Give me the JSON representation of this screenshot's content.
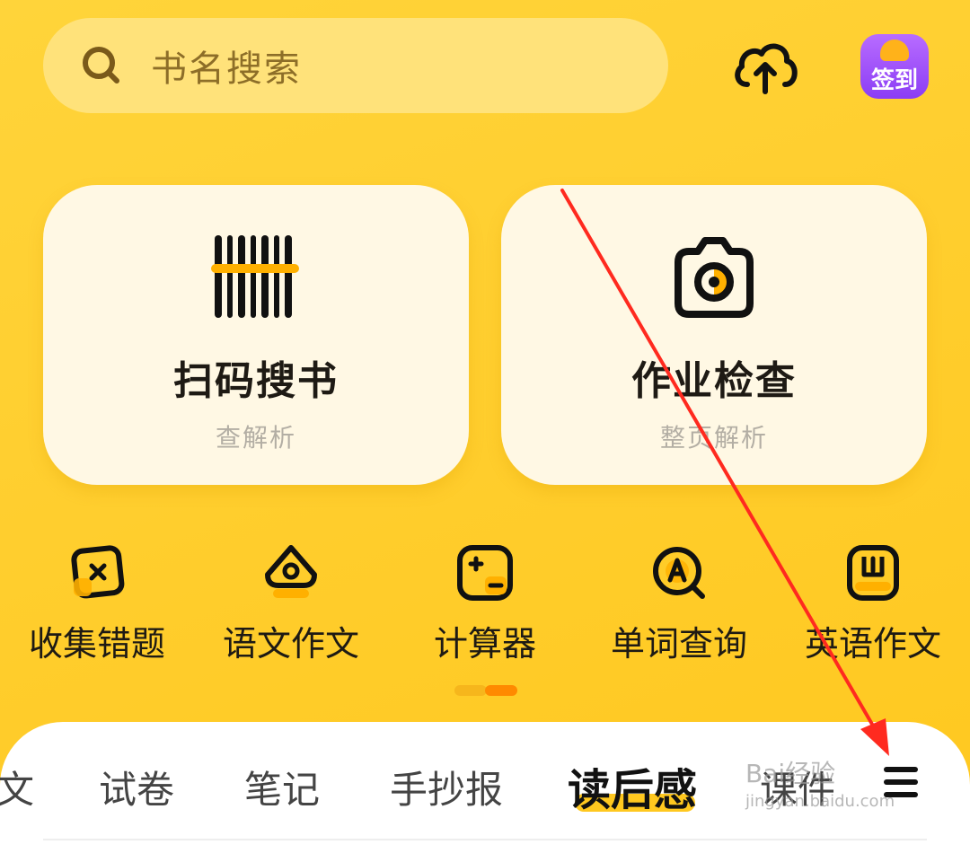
{
  "search": {
    "placeholder": "书名搜索"
  },
  "header": {
    "checkin_label": "签到"
  },
  "cards": [
    {
      "title": "扫码搜书",
      "subtitle": "查解析",
      "icon": "barcode-scan-icon"
    },
    {
      "title": "作业检查",
      "subtitle": "整页解析",
      "icon": "camera-icon"
    }
  ],
  "tools": [
    {
      "label": "收集错题",
      "icon": "error-collection-icon"
    },
    {
      "label": "语文作文",
      "icon": "pen-nib-icon"
    },
    {
      "label": "计算器",
      "icon": "calculator-icon"
    },
    {
      "label": "单词查询",
      "icon": "word-search-icon"
    },
    {
      "label": "英语作文",
      "icon": "english-book-icon"
    }
  ],
  "tabs": {
    "items": [
      "文",
      "试卷",
      "笔记",
      "手抄报",
      "读后感",
      "课件"
    ],
    "active": "读后感"
  },
  "watermark": {
    "brand": "Bai",
    "brand_cn": "经验",
    "url": "jingyan.baidu.com"
  },
  "colors": {
    "accent": "#FFC81F",
    "annotation": "#FF2A1F",
    "checkin": "#8B3DF5"
  }
}
